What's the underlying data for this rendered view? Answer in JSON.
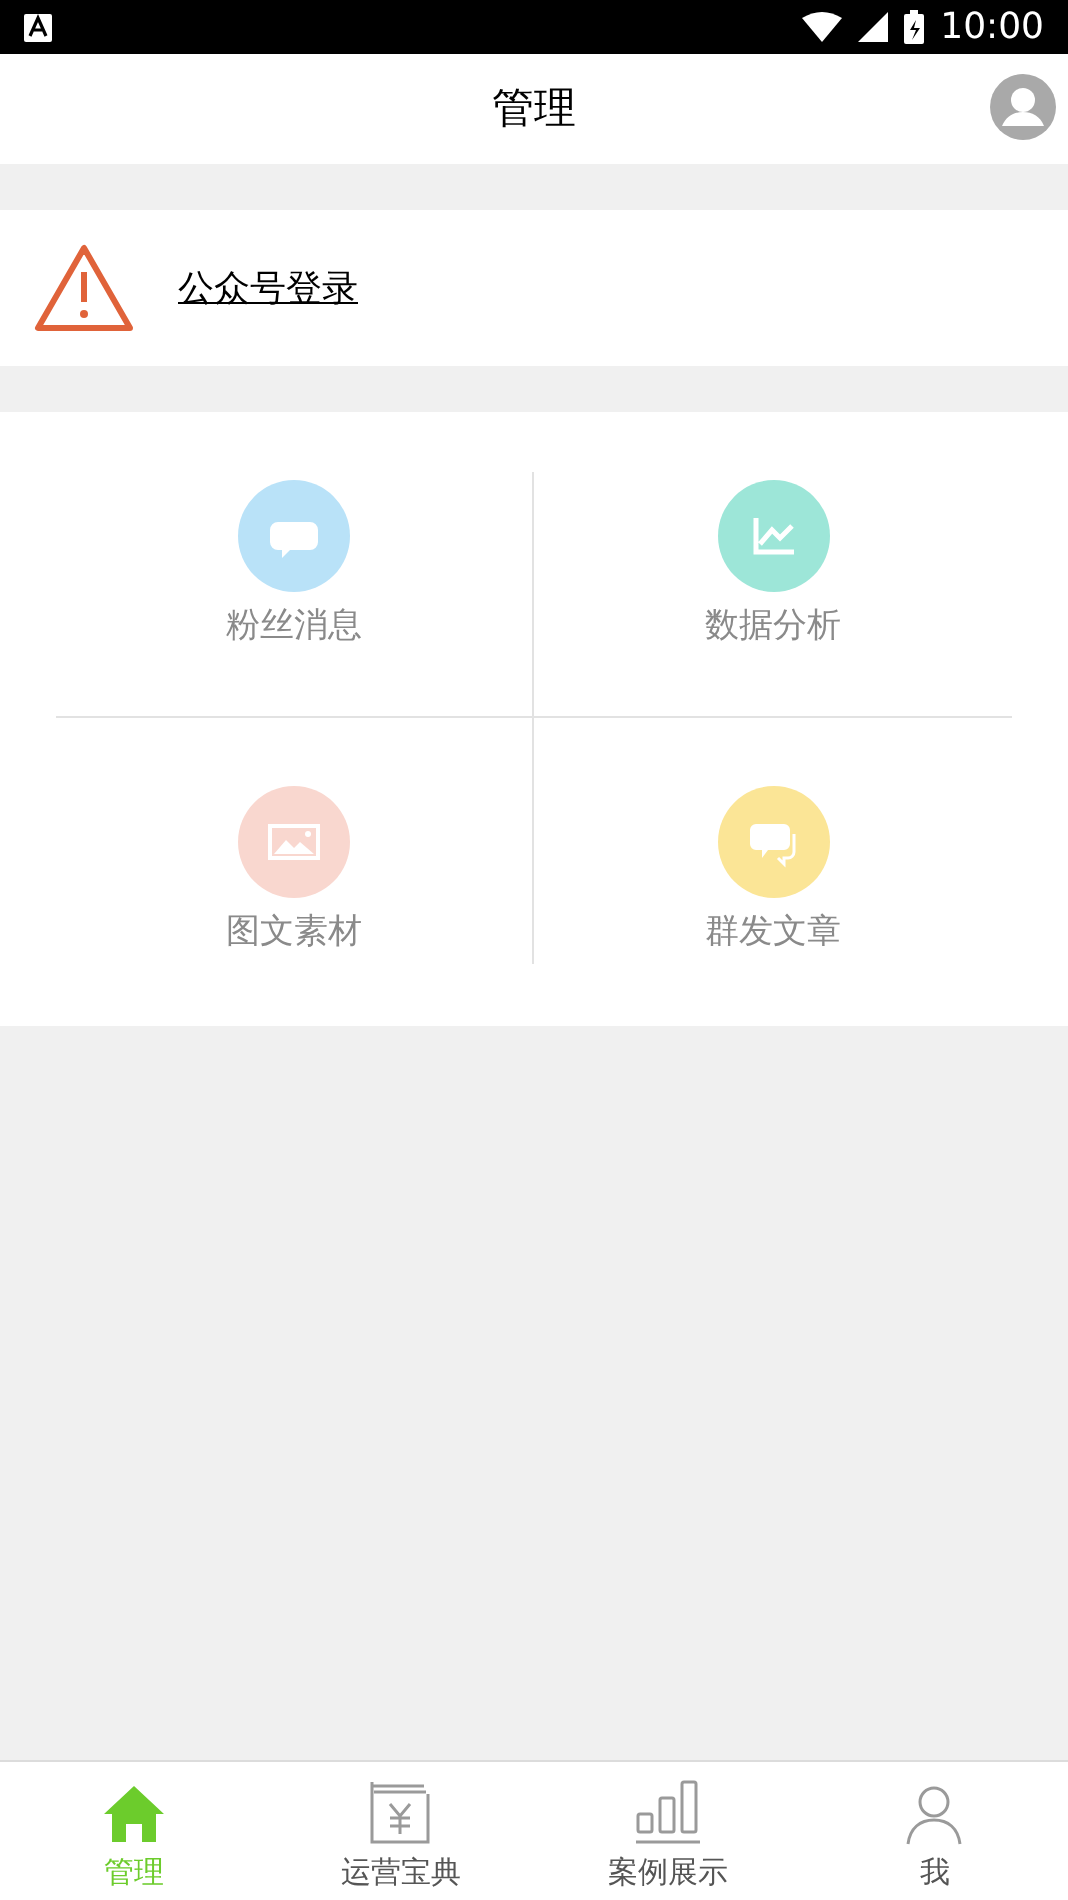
{
  "status_bar": {
    "time": "10:00"
  },
  "header": {
    "title": "管理"
  },
  "login_row": {
    "label": "公众号登录"
  },
  "grid": [
    {
      "kind": "message",
      "label": "粉丝消息",
      "color": "#b9e2f8"
    },
    {
      "kind": "analytics",
      "label": "数据分析",
      "color": "#9de6d8"
    },
    {
      "kind": "image",
      "label": "图文素材",
      "color": "#f9d7cf"
    },
    {
      "kind": "article",
      "label": "群发文章",
      "color": "#fbe596"
    }
  ],
  "tabs": [
    {
      "kind": "home",
      "label": "管理",
      "selected": true
    },
    {
      "kind": "book",
      "label": "运营宝典",
      "selected": false
    },
    {
      "kind": "bars",
      "label": "案例展示",
      "selected": false
    },
    {
      "kind": "person",
      "label": "我",
      "selected": false
    }
  ]
}
